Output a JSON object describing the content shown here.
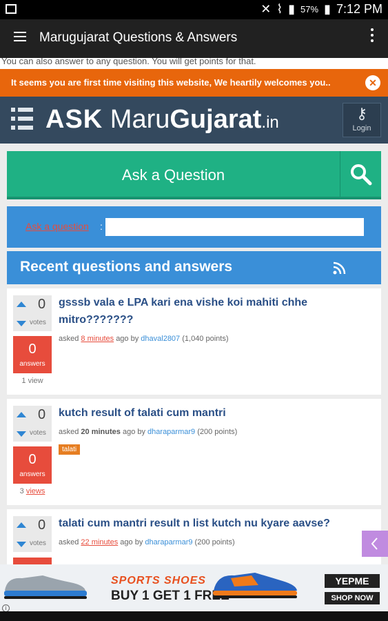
{
  "status_bar": {
    "battery": "57%",
    "time": "7:12 PM"
  },
  "app_bar": {
    "title": "Marugujarat Questions & Answers"
  },
  "notice_text": "You can also answer to any question. You will get points for that.",
  "welcome_banner": {
    "text": "It seems you are first time visiting this website, We heartily welcomes you..",
    "close": "✕"
  },
  "header": {
    "logo": {
      "ask": "ASK",
      "maru": "Maru",
      "gujarat": "Gujarat",
      "in": ".in"
    },
    "login_label": "Login"
  },
  "ask_bar": {
    "label": "Ask a Question"
  },
  "search": {
    "label": "Ask a question",
    "colon": ":",
    "placeholder": ""
  },
  "recent": {
    "title": "Recent questions and answers"
  },
  "questions": [
    {
      "votes": "0",
      "votes_label": "votes",
      "answers": "0",
      "answers_label": "answers",
      "views_count": "1",
      "views_label": "view",
      "title": "gsssb vala e LPA kari ena vishe koi mahiti chhe mitro???????",
      "asked": "asked",
      "time": "8 minutes",
      "ago_by": "ago by",
      "user": "dhaval2807",
      "points": "(1,040 points)"
    },
    {
      "votes": "0",
      "votes_label": "votes",
      "answers": "0",
      "answers_label": "answers",
      "views_count": "3",
      "views_label": "views",
      "title": "kutch result of talati cum mantri",
      "asked": "asked",
      "time": "20 minutes",
      "ago_by": "ago by",
      "user": "dharaparmar9",
      "points": "(200 points)",
      "tag": "talati"
    },
    {
      "votes": "0",
      "votes_label": "votes",
      "title": "talati cum mantri result n list kutch nu kyare aavse?",
      "asked": "asked",
      "time": "22 minutes",
      "ago_by": "ago by",
      "user": "dharaparmar9",
      "points": "(200 points)"
    }
  ],
  "ad": {
    "sports": "SPORTS SHOES",
    "offer": "BUY 1 GET 1 FREE",
    "brand": "YEPME",
    "cta": "SHOP NOW",
    "info": "i"
  },
  "colors": {
    "accent_green": "#1fb184",
    "accent_blue": "#3a8fd8",
    "accent_orange": "#e8660c",
    "header_navy": "#34495e",
    "answer_red": "#e74c3c"
  }
}
